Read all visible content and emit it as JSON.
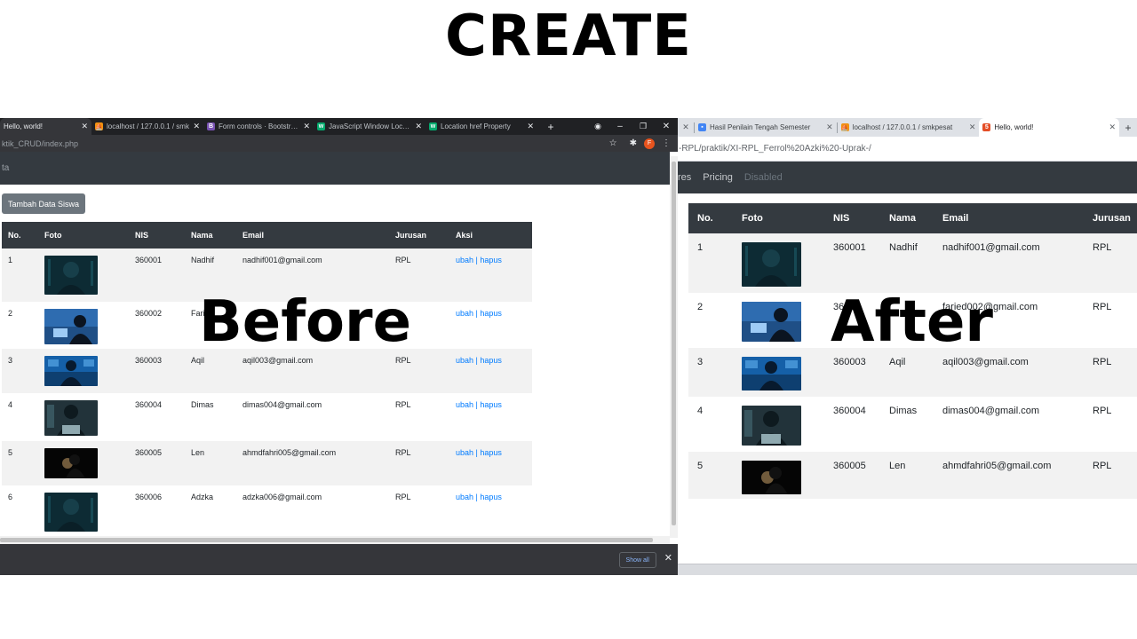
{
  "headline": "CREATE",
  "before_label": "Before",
  "after_label": "After",
  "before": {
    "tabs": [
      {
        "title": "Hello, world!",
        "icon": "",
        "active": true
      },
      {
        "title": "localhost / 127.0.0.1 / smk",
        "icon": "phpmyadmin-icon",
        "active": false
      },
      {
        "title": "Form controls · Bootstrap v",
        "icon": "bootstrap-icon",
        "active": false
      },
      {
        "title": "JavaScript Window Location",
        "icon": "w3schools-icon",
        "active": false
      },
      {
        "title": "Location href Property",
        "icon": "w3schools-icon",
        "active": false
      }
    ],
    "new_tab": "+",
    "url": "ktik_CRUD/index.php",
    "navbar_text": "ta",
    "profile_letter": "F",
    "add_button": "Tambah Data Siswa",
    "columns": [
      "No.",
      "Foto",
      "NIS",
      "Nama",
      "Email",
      "Jurusan",
      "Aksi"
    ],
    "rows": [
      {
        "no": "1",
        "nis": "360001",
        "nama": "Nadhif",
        "email": "nadhif001@gmail.com",
        "jurusan": "RPL",
        "ubah": "ubah",
        "sep": "|",
        "hapus": "hapus"
      },
      {
        "no": "2",
        "nis": "360002",
        "nama": "Fari",
        "email": "",
        "jurusan": "",
        "ubah": "ubah",
        "sep": "|",
        "hapus": "hapus"
      },
      {
        "no": "3",
        "nis": "360003",
        "nama": "Aqil",
        "email": "aqil003@gmail.com",
        "jurusan": "RPL",
        "ubah": "ubah",
        "sep": "|",
        "hapus": "hapus"
      },
      {
        "no": "4",
        "nis": "360004",
        "nama": "Dimas",
        "email": "dimas004@gmail.com",
        "jurusan": "RPL",
        "ubah": "ubah",
        "sep": "|",
        "hapus": "hapus"
      },
      {
        "no": "5",
        "nis": "360005",
        "nama": "Len",
        "email": "ahmdfahri005@gmail.com",
        "jurusan": "RPL",
        "ubah": "ubah",
        "sep": "|",
        "hapus": "hapus"
      },
      {
        "no": "6",
        "nis": "360006",
        "nama": "Adzka",
        "email": "adzka006@gmail.com",
        "jurusan": "RPL",
        "ubah": "ubah",
        "sep": "|",
        "hapus": "hapus"
      }
    ],
    "show_all": "Show all",
    "close": "✕"
  },
  "after": {
    "tabs": [
      {
        "title": "Hasil Penilain Tengah Semester",
        "icon": "docs-icon",
        "active": false
      },
      {
        "title": "localhost / 127.0.0.1 / smkpesat",
        "icon": "phpmyadmin-icon",
        "active": false
      },
      {
        "title": "Hello, world!",
        "icon": "html-icon",
        "active": true
      }
    ],
    "url": "-RPL/praktik/XI-RPL_Ferrol%20Azki%20-Uprak-/",
    "nav_links": [
      {
        "label": "res",
        "disabled": false
      },
      {
        "label": "Pricing",
        "disabled": false
      },
      {
        "label": "Disabled",
        "disabled": true
      }
    ],
    "columns": [
      "No.",
      "Foto",
      "NIS",
      "Nama",
      "Email",
      "Jurusan"
    ],
    "rows": [
      {
        "no": "1",
        "nis": "360001",
        "nama": "Nadhif",
        "email": "nadhif001@gmail.com",
        "jurusan": "RPL"
      },
      {
        "no": "2",
        "nis": "3600",
        "nama": "",
        "email": "faried002@gmail.com",
        "jurusan": "RPL"
      },
      {
        "no": "3",
        "nis": "360003",
        "nama": "Aqil",
        "email": "aqil003@gmail.com",
        "jurusan": "RPL"
      },
      {
        "no": "4",
        "nis": "360004",
        "nama": "Dimas",
        "email": "dimas004@gmail.com",
        "jurusan": "RPL"
      },
      {
        "no": "5",
        "nis": "360005",
        "nama": "Len",
        "email": "ahmdfahri05@gmail.com",
        "jurusan": "RPL"
      }
    ]
  },
  "colors": {
    "table_header": "#343a40",
    "link": "#007bff",
    "button_secondary": "#6c757d",
    "chrome_dark": "#202124",
    "profile": "#e8541e"
  }
}
